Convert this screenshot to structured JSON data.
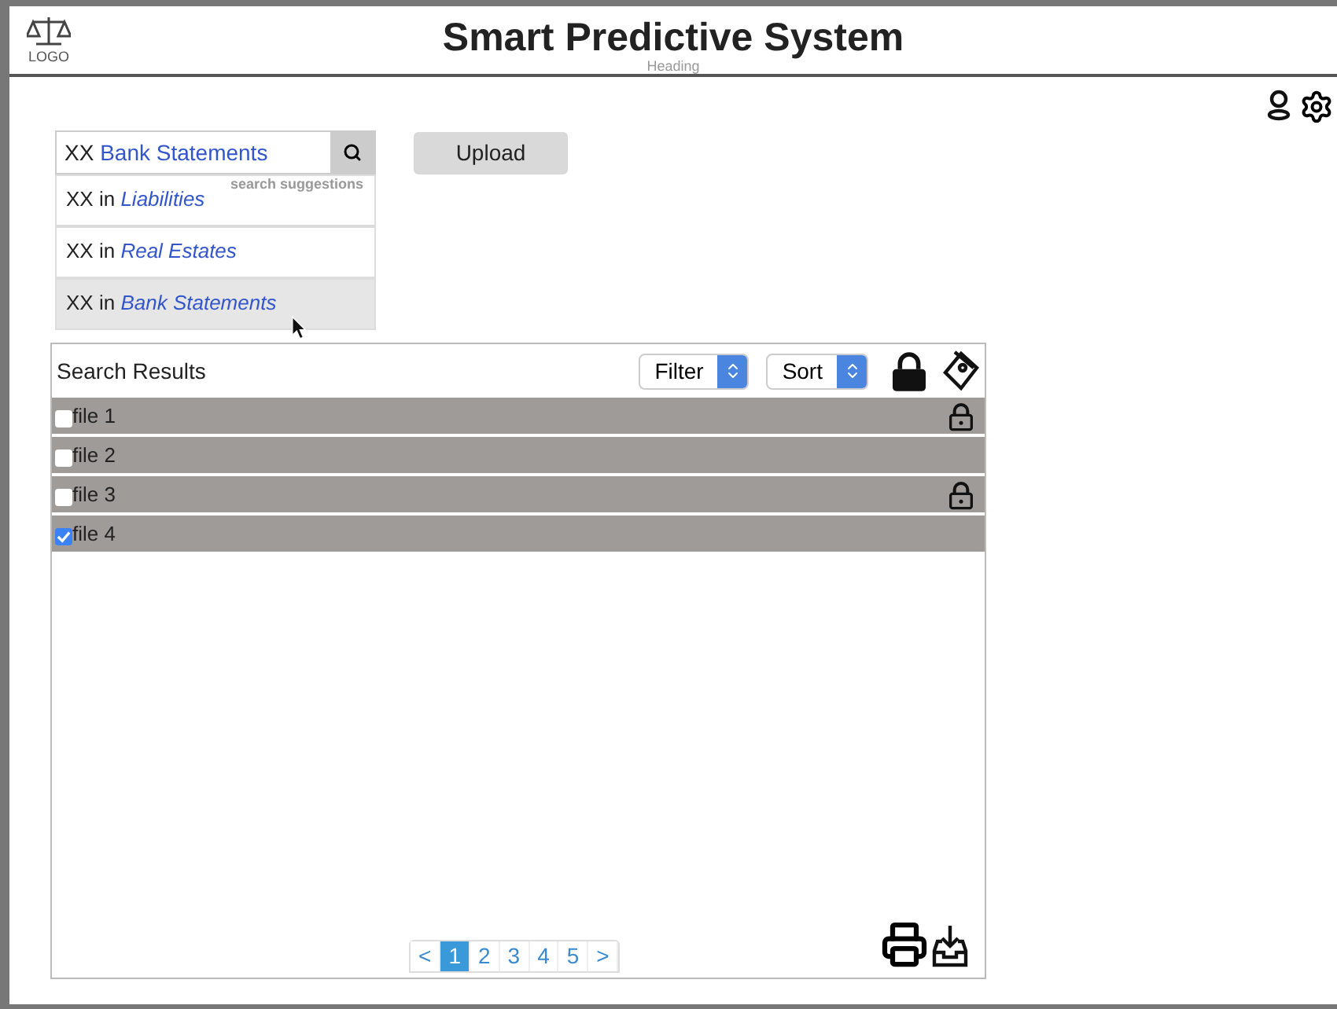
{
  "header": {
    "logo": "LOGO",
    "title": "Smart Predictive System",
    "subtitle": "Heading"
  },
  "search": {
    "prefix": "XX",
    "term": "Bank Statements",
    "hint": "search suggestions"
  },
  "suggestions": [
    {
      "prefix": "XX in",
      "category": "Liabilities",
      "selected": false
    },
    {
      "prefix": "XX in",
      "category": "Real Estates",
      "selected": false
    },
    {
      "prefix": "XX in",
      "category": "Bank Statements",
      "selected": true
    }
  ],
  "upload_button": "Upload",
  "results": {
    "title": "Search Results",
    "filter": "Filter",
    "sort": "Sort",
    "rows": [
      {
        "name": "file 1",
        "checked": false,
        "locked": true
      },
      {
        "name": "file 2",
        "checked": false,
        "locked": false
      },
      {
        "name": "file 3",
        "checked": false,
        "locked": true
      },
      {
        "name": "file 4",
        "checked": true,
        "locked": false
      }
    ]
  },
  "pagination": [
    {
      "label": "<",
      "selected": false
    },
    {
      "label": "1",
      "selected": true
    },
    {
      "label": "2",
      "selected": false
    },
    {
      "label": "3",
      "selected": false
    },
    {
      "label": "4",
      "selected": false
    },
    {
      "label": "5",
      "selected": false
    },
    {
      "label": ">",
      "selected": false
    }
  ]
}
